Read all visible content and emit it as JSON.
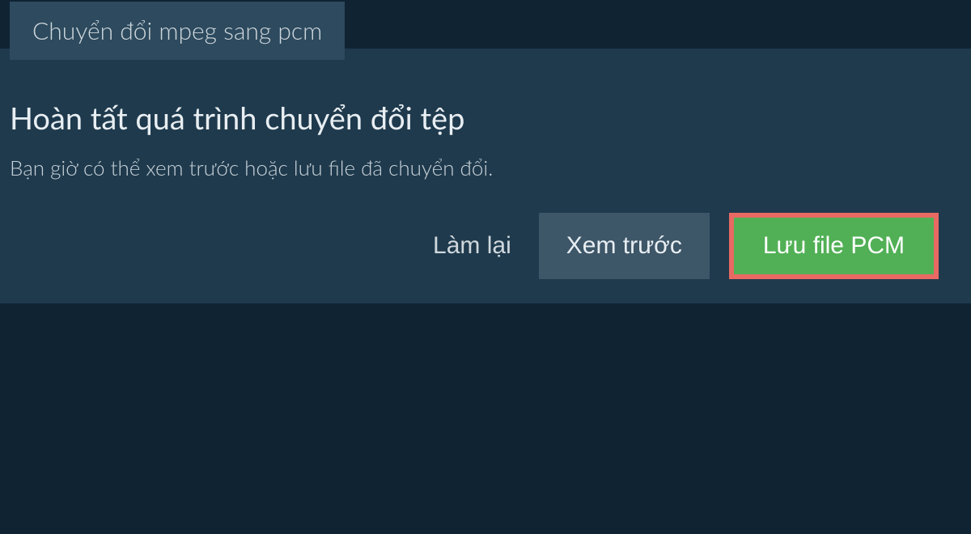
{
  "tab": {
    "label": "Chuyển đổi mpeg sang pcm"
  },
  "main": {
    "heading": "Hoàn tất quá trình chuyển đổi tệp",
    "description": "Bạn giờ có thể xem trước hoặc lưu file đã chuyển đổi."
  },
  "buttons": {
    "reset": "Làm lại",
    "preview": "Xem trước",
    "save": "Lưu file PCM"
  }
}
